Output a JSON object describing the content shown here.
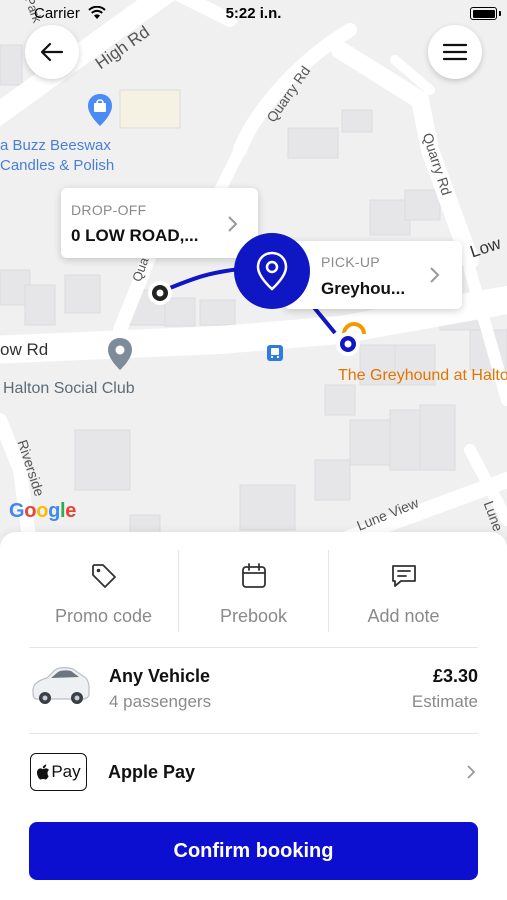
{
  "status_bar": {
    "carrier": "Carrier",
    "time": "5:22 i.n."
  },
  "map": {
    "streets": {
      "high_rd": "High Rd",
      "quarry_rd_1": "Quarry Rd",
      "quarry_rd_2": "Quarry Rd",
      "low_rd_left": "ow Rd",
      "low_rd_right": "Low",
      "riverside": "Riverside",
      "lune_view": "Lune View",
      "lune_right": "Lune",
      "park": "Park",
      "qua": "Qua"
    },
    "pois": {
      "buzz_line1": "a Buzz Beeswax",
      "buzz_line2": "Candles & Polish",
      "halton_social": "Halton Social Club",
      "greyhound": "The Greyhound at Halto"
    },
    "dropoff": {
      "kicker": "DROP-OFF",
      "address": "0 LOW ROAD,..."
    },
    "pickup": {
      "kicker": "PICK-UP",
      "address": "Greyhou..."
    },
    "google_logo": [
      "G",
      "o",
      "o",
      "g",
      "l",
      "e"
    ],
    "google_colors": [
      "#4285F4",
      "#EA4335",
      "#FBBC05",
      "#4285F4",
      "#34A853",
      "#EA4335"
    ],
    "route_color": "#0f16c4",
    "poi_orange": "#e37400"
  },
  "sheet": {
    "actions": [
      {
        "label": "Promo code",
        "icon": "tag-icon"
      },
      {
        "label": "Prebook",
        "icon": "calendar-icon"
      },
      {
        "label": "Add note",
        "icon": "message-icon"
      }
    ],
    "vehicle": {
      "name": "Any Vehicle",
      "passengers": "4 passengers",
      "price": "£3.30",
      "price_note": "Estimate"
    },
    "payment": {
      "mark": "Pay",
      "label": "Apple Pay"
    },
    "confirm_label": "Confirm booking",
    "accent": "#0c0fcf"
  }
}
